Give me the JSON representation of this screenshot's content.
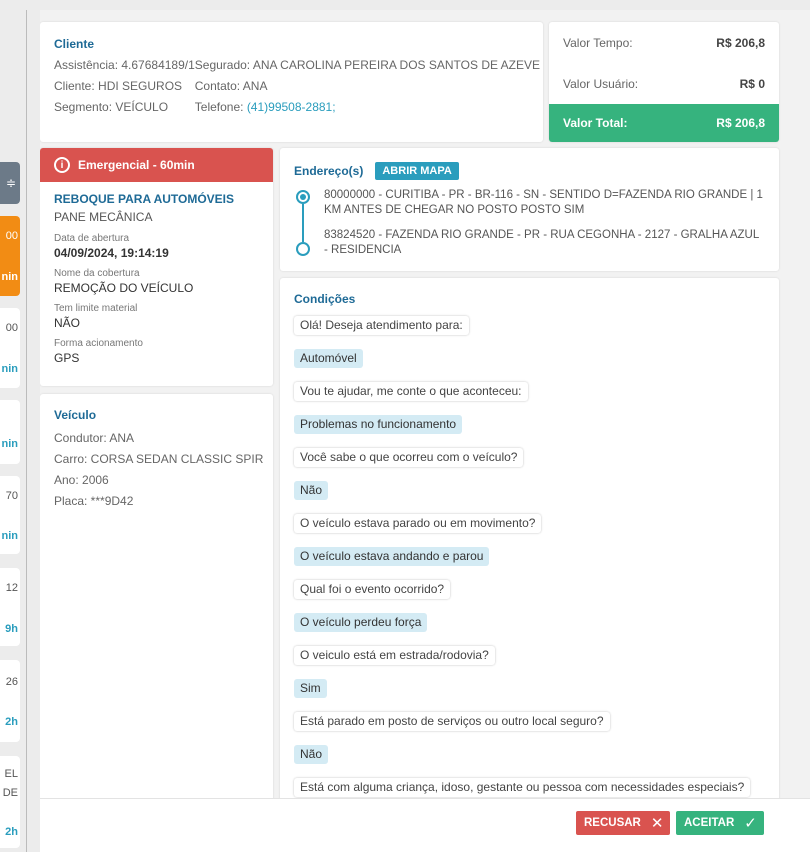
{
  "background_list": {
    "filter_glyph": "≑",
    "cards": [
      {
        "top": "00",
        "bottom": "nin"
      },
      {
        "top": "00",
        "bottom": "nin"
      },
      {
        "top": "",
        "bottom": "nin"
      },
      {
        "top": "70",
        "bottom": "nin"
      },
      {
        "top": "12",
        "bottom": "9h"
      },
      {
        "top": "26",
        "bottom": "2h"
      },
      {
        "top": "EL",
        "mid": "DE",
        "bottom": "2h"
      }
    ]
  },
  "client": {
    "title": "Cliente",
    "assistencia": "Assistência: 4.67684189/1",
    "cliente": "Cliente: HDI SEGUROS",
    "segmento": "Segmento: VEÍCULO",
    "segurado": "Segurado: ANA CAROLINA PEREIRA DOS SANTOS DE AZEVE",
    "contato": "Contato: ANA",
    "telefone_label": "Telefone: ",
    "telefone_value": "(41)99508-2881;"
  },
  "values": {
    "tempo_label": "Valor Tempo:",
    "tempo_value": "R$ 206,8",
    "usuario_label": "Valor Usuário:",
    "usuario_value": "R$ 0",
    "total_label": "Valor Total:",
    "total_value": "R$ 206,8",
    "total_color": "#36b37e"
  },
  "emergency": {
    "header": "Emergencial - 60min",
    "header_color": "#d9534f",
    "service": "REBOQUE PARA AUTOMÓVEIS",
    "problem": "PANE MECÂNICA",
    "opened_label": "Data de abertura",
    "opened_value": "04/09/2024, 19:14:19",
    "coverage_label": "Nome da cobertura",
    "coverage_value": "REMOÇÃO DO VEÍCULO",
    "limit_label": "Tem limite material",
    "limit_value": "NÃO",
    "trigger_label": "Forma acionamento",
    "trigger_value": "GPS"
  },
  "vehicle": {
    "title": "Veículo",
    "condutor": "Condutor: ANA",
    "carro": "Carro: CORSA SEDAN CLASSIC SPIR",
    "ano": "Ano: 2006",
    "placa": "Placa: ***9D42"
  },
  "address": {
    "title": "Endereço(s)",
    "map_button": "ABRIR MAPA",
    "origin": "80000000 - CURITIBA - PR - BR-116 - SN - SENTIDO D=FAZENDA RIO GRANDE | 1 KM ANTES DE CHEGAR NO POSTO POSTO SIM",
    "destination": "83824520 - FAZENDA RIO GRANDE - PR - RUA CEGONHA - 2127 - GRALHA AZUL - RESIDENCIA"
  },
  "conditions": {
    "title": "Condições",
    "messages": [
      {
        "type": "q",
        "text": "Olá! Deseja atendimento para:"
      },
      {
        "type": "a",
        "text": "Automóvel"
      },
      {
        "type": "q",
        "text": "Vou te ajudar, me conte o que aconteceu:"
      },
      {
        "type": "a",
        "text": "Problemas no funcionamento"
      },
      {
        "type": "q",
        "text": "Você sabe o que ocorreu com o veículo?"
      },
      {
        "type": "a",
        "text": "Não"
      },
      {
        "type": "q",
        "text": "O veículo estava parado ou em movimento?"
      },
      {
        "type": "a",
        "text": "O veículo estava andando e parou"
      },
      {
        "type": "q",
        "text": "Qual foi o evento ocorrido?"
      },
      {
        "type": "a",
        "text": "O veículo perdeu força"
      },
      {
        "type": "q",
        "text": "O veiculo está em estrada/rodovia?"
      },
      {
        "type": "a",
        "text": "Sim"
      },
      {
        "type": "q",
        "text": "Está parado em posto de serviços ou outro local seguro?"
      },
      {
        "type": "a",
        "text": "Não"
      },
      {
        "type": "q",
        "text": "Está com alguma criança, idoso, gestante ou pessoa com necessidades especiais?"
      }
    ]
  },
  "footer": {
    "reject_label": "RECUSAR",
    "reject_icon": "close-icon",
    "accept_label": "ACEITAR",
    "accept_icon": "check-icon",
    "reject_color": "#d9534f",
    "accept_color": "#36b37e"
  }
}
